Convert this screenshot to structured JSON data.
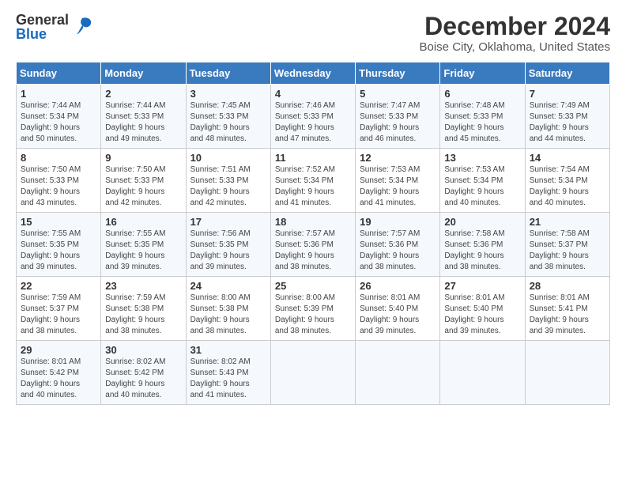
{
  "logo": {
    "general": "General",
    "blue": "Blue"
  },
  "title": "December 2024",
  "subtitle": "Boise City, Oklahoma, United States",
  "weekdays": [
    "Sunday",
    "Monday",
    "Tuesday",
    "Wednesday",
    "Thursday",
    "Friday",
    "Saturday"
  ],
  "weeks": [
    [
      {
        "day": "1",
        "info": "Sunrise: 7:44 AM\nSunset: 5:34 PM\nDaylight: 9 hours\nand 50 minutes."
      },
      {
        "day": "2",
        "info": "Sunrise: 7:44 AM\nSunset: 5:33 PM\nDaylight: 9 hours\nand 49 minutes."
      },
      {
        "day": "3",
        "info": "Sunrise: 7:45 AM\nSunset: 5:33 PM\nDaylight: 9 hours\nand 48 minutes."
      },
      {
        "day": "4",
        "info": "Sunrise: 7:46 AM\nSunset: 5:33 PM\nDaylight: 9 hours\nand 47 minutes."
      },
      {
        "day": "5",
        "info": "Sunrise: 7:47 AM\nSunset: 5:33 PM\nDaylight: 9 hours\nand 46 minutes."
      },
      {
        "day": "6",
        "info": "Sunrise: 7:48 AM\nSunset: 5:33 PM\nDaylight: 9 hours\nand 45 minutes."
      },
      {
        "day": "7",
        "info": "Sunrise: 7:49 AM\nSunset: 5:33 PM\nDaylight: 9 hours\nand 44 minutes."
      }
    ],
    [
      {
        "day": "8",
        "info": "Sunrise: 7:50 AM\nSunset: 5:33 PM\nDaylight: 9 hours\nand 43 minutes."
      },
      {
        "day": "9",
        "info": "Sunrise: 7:50 AM\nSunset: 5:33 PM\nDaylight: 9 hours\nand 42 minutes."
      },
      {
        "day": "10",
        "info": "Sunrise: 7:51 AM\nSunset: 5:33 PM\nDaylight: 9 hours\nand 42 minutes."
      },
      {
        "day": "11",
        "info": "Sunrise: 7:52 AM\nSunset: 5:34 PM\nDaylight: 9 hours\nand 41 minutes."
      },
      {
        "day": "12",
        "info": "Sunrise: 7:53 AM\nSunset: 5:34 PM\nDaylight: 9 hours\nand 41 minutes."
      },
      {
        "day": "13",
        "info": "Sunrise: 7:53 AM\nSunset: 5:34 PM\nDaylight: 9 hours\nand 40 minutes."
      },
      {
        "day": "14",
        "info": "Sunrise: 7:54 AM\nSunset: 5:34 PM\nDaylight: 9 hours\nand 40 minutes."
      }
    ],
    [
      {
        "day": "15",
        "info": "Sunrise: 7:55 AM\nSunset: 5:35 PM\nDaylight: 9 hours\nand 39 minutes."
      },
      {
        "day": "16",
        "info": "Sunrise: 7:55 AM\nSunset: 5:35 PM\nDaylight: 9 hours\nand 39 minutes."
      },
      {
        "day": "17",
        "info": "Sunrise: 7:56 AM\nSunset: 5:35 PM\nDaylight: 9 hours\nand 39 minutes."
      },
      {
        "day": "18",
        "info": "Sunrise: 7:57 AM\nSunset: 5:36 PM\nDaylight: 9 hours\nand 38 minutes."
      },
      {
        "day": "19",
        "info": "Sunrise: 7:57 AM\nSunset: 5:36 PM\nDaylight: 9 hours\nand 38 minutes."
      },
      {
        "day": "20",
        "info": "Sunrise: 7:58 AM\nSunset: 5:36 PM\nDaylight: 9 hours\nand 38 minutes."
      },
      {
        "day": "21",
        "info": "Sunrise: 7:58 AM\nSunset: 5:37 PM\nDaylight: 9 hours\nand 38 minutes."
      }
    ],
    [
      {
        "day": "22",
        "info": "Sunrise: 7:59 AM\nSunset: 5:37 PM\nDaylight: 9 hours\nand 38 minutes."
      },
      {
        "day": "23",
        "info": "Sunrise: 7:59 AM\nSunset: 5:38 PM\nDaylight: 9 hours\nand 38 minutes."
      },
      {
        "day": "24",
        "info": "Sunrise: 8:00 AM\nSunset: 5:38 PM\nDaylight: 9 hours\nand 38 minutes."
      },
      {
        "day": "25",
        "info": "Sunrise: 8:00 AM\nSunset: 5:39 PM\nDaylight: 9 hours\nand 38 minutes."
      },
      {
        "day": "26",
        "info": "Sunrise: 8:01 AM\nSunset: 5:40 PM\nDaylight: 9 hours\nand 39 minutes."
      },
      {
        "day": "27",
        "info": "Sunrise: 8:01 AM\nSunset: 5:40 PM\nDaylight: 9 hours\nand 39 minutes."
      },
      {
        "day": "28",
        "info": "Sunrise: 8:01 AM\nSunset: 5:41 PM\nDaylight: 9 hours\nand 39 minutes."
      }
    ],
    [
      {
        "day": "29",
        "info": "Sunrise: 8:01 AM\nSunset: 5:42 PM\nDaylight: 9 hours\nand 40 minutes."
      },
      {
        "day": "30",
        "info": "Sunrise: 8:02 AM\nSunset: 5:42 PM\nDaylight: 9 hours\nand 40 minutes."
      },
      {
        "day": "31",
        "info": "Sunrise: 8:02 AM\nSunset: 5:43 PM\nDaylight: 9 hours\nand 41 minutes."
      },
      {
        "day": "",
        "info": ""
      },
      {
        "day": "",
        "info": ""
      },
      {
        "day": "",
        "info": ""
      },
      {
        "day": "",
        "info": ""
      }
    ]
  ]
}
